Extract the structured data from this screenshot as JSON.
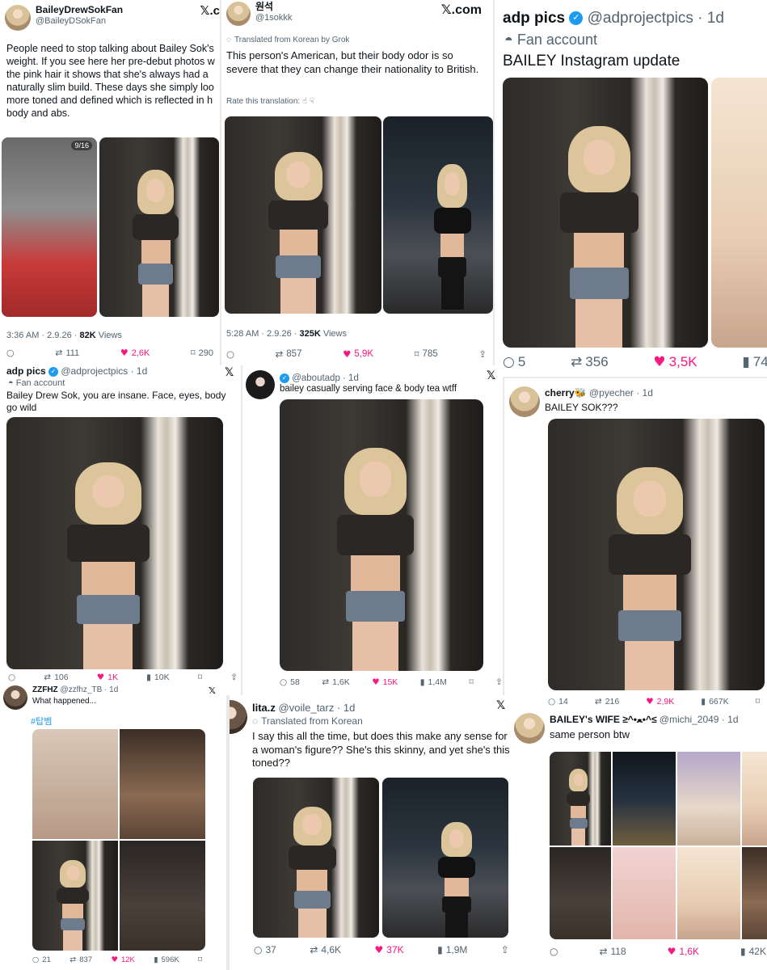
{
  "tweet1": {
    "name": "BaileyDrewSokFan",
    "handle": "@BaileyDSokFan",
    "x_logo": "𝕏.c",
    "text": "People need to stop talking about Bailey Sok's weight. If you see here her pre-debut photos w the pink hair it shows that she's always had a naturally slim build. These days she simply loo more toned and defined which is reflected in h body and abs.",
    "meta_time": "3:36 AM · 2.9.26 · ",
    "meta_views": "82K",
    "meta_views_label": " Views",
    "counter": "9/16",
    "actions": {
      "replies": "",
      "reposts": "111",
      "likes": "2,6K",
      "bookmarks": "290"
    }
  },
  "tweet2": {
    "name": "원석",
    "handle": "@1sokkk",
    "x_logo": "𝕏.com",
    "translated": "Translated from Korean by Grok",
    "text": "This person's American, but their body odor is so severe that they can change their nationality to British.",
    "rate": "Rate this translation:",
    "meta_time": "5:28 AM · 2.9.26 · ",
    "meta_views": "325K",
    "meta_views_label": " Views",
    "actions": {
      "replies": "",
      "reposts": "857",
      "likes": "5,9K",
      "bookmarks": "785"
    }
  },
  "tweet3": {
    "name": "adp pics",
    "handle": "@adprojectpics · 1d",
    "fan_account": "Fan account",
    "text": "BAILEY Instagram update",
    "actions": {
      "replies": "5",
      "reposts": "356",
      "likes": "3,5K",
      "views": "74K"
    }
  },
  "tweet4": {
    "name": "adp pics",
    "handle": "@adprojectpics · 1d",
    "fan_account": "Fan account",
    "text": "Bailey Drew Sok, you are insane. Face, eyes, body go wild",
    "actions": {
      "replies": "",
      "reposts": "106",
      "likes": "1K",
      "views": "10K"
    }
  },
  "tweet5": {
    "handle": "@aboutadp · 1d",
    "text": "bailey casually serving face & body tea wtff",
    "actions": {
      "replies": "58",
      "reposts": "1,6K",
      "likes": "15K",
      "views": "1,4M"
    }
  },
  "tweet6": {
    "name": "cherry🐝",
    "handle": "@pyecher · 1d",
    "text": "BAILEY SOK???",
    "actions": {
      "replies": "14",
      "reposts": "216",
      "likes": "2,9K",
      "views": "667K"
    }
  },
  "tweet7": {
    "name": "ZZFHZ",
    "handle": "@zzfhz_TB · 1d",
    "text": "What happened...",
    "hashtag": "#탑벰",
    "actions": {
      "replies": "21",
      "reposts": "837",
      "likes": "12K",
      "views": "596K"
    }
  },
  "tweet8": {
    "name": "lita.z",
    "handle": "@voile_tarz · 1d",
    "translated": "Translated from Korean",
    "text": "I say this all the time, but does this make any sense for a woman's figure?? She's this skinny, and yet she's this toned??",
    "actions": {
      "replies": "37",
      "reposts": "4,6K",
      "likes": "37K",
      "views": "1,9M"
    }
  },
  "tweet9": {
    "name": "BAILEY's WIFE ≥^•ﻌ•^≤",
    "handle": "@michi_2049 · 1d",
    "text": "same person btw",
    "actions": {
      "replies": "",
      "reposts": "118",
      "likes": "1,6K",
      "views": "42K"
    }
  },
  "icons": {
    "reply": "○",
    "repost": "⇄",
    "like": "♥",
    "views": "▮",
    "bookmark": "⌑",
    "share": "⇪",
    "x": "𝕏"
  }
}
